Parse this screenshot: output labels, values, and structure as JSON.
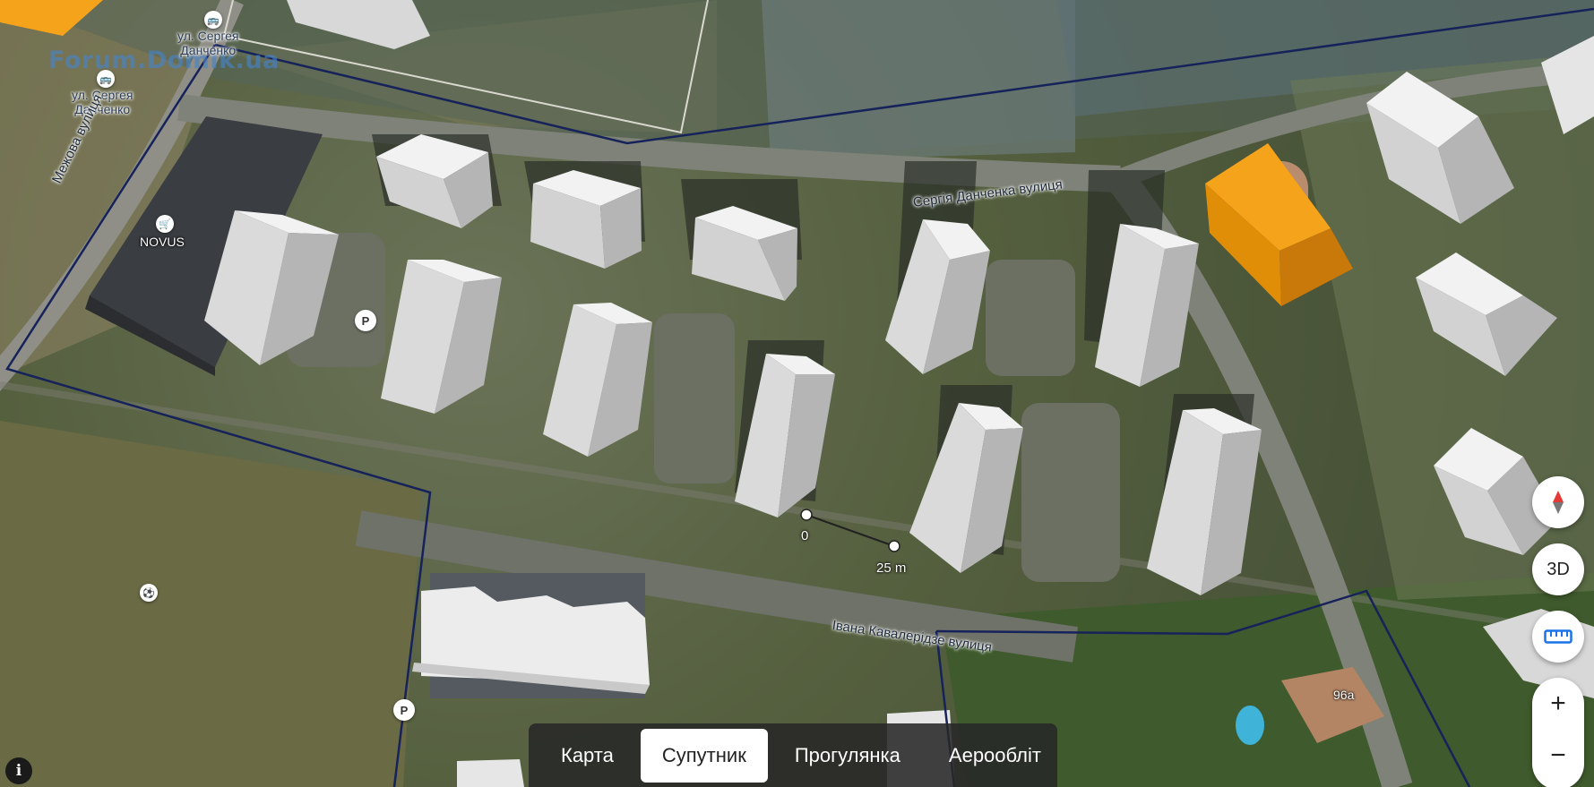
{
  "map": {
    "watermark": "Forum.Domik.ua",
    "labels": {
      "bus_stop_top": "ул. Сергея\nДанченко",
      "bus_stop_left": "ул. Сергея\nДанченко",
      "mezhova_street": "Межова вулиця",
      "novus": "NOVUS",
      "sergiy_danchenko_street": "Сергія Данченка вулиця",
      "ivana_kavaleridze_street": "Івана Кавалерідзе вулиця",
      "address_96a": "96а"
    },
    "poi": {
      "parking_symbol": "P",
      "info_symbol": "i"
    },
    "scale": {
      "start": "0",
      "end": "25 m"
    },
    "highlight_color": "#f29b12",
    "boundary_color": "#16225a"
  },
  "controls": {
    "compass": "compass-icon",
    "view_3d": "3D",
    "ruler": "ruler-icon",
    "zoom_in": "+",
    "zoom_out": "−"
  },
  "modes": {
    "items": [
      {
        "label": "Карта",
        "active": false
      },
      {
        "label": "Супутник",
        "active": true
      },
      {
        "label": "Прогулянка",
        "active": false
      },
      {
        "label": "Аерообліт",
        "active": false
      }
    ]
  }
}
